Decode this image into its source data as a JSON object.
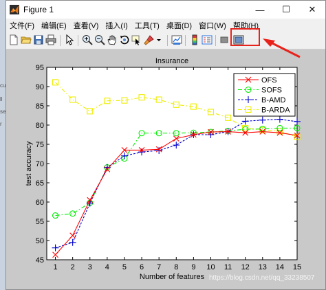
{
  "window": {
    "title": "Figure 1",
    "minimize_glyph": "—",
    "maximize_glyph": "☐",
    "close_glyph": "✕"
  },
  "menu": [
    {
      "key": "file",
      "label": "文件(F)"
    },
    {
      "key": "edit",
      "label": "编辑(E)"
    },
    {
      "key": "view",
      "label": "查看(V)"
    },
    {
      "key": "insert",
      "label": "插入(I)"
    },
    {
      "key": "tools",
      "label": "工具(T)"
    },
    {
      "key": "desktop",
      "label": "桌面(D)"
    },
    {
      "key": "window",
      "label": "窗口(W)"
    },
    {
      "key": "help",
      "label": "帮助(H)"
    }
  ],
  "toolbar_icons": [
    "new-figure-icon",
    "open-file-icon",
    "save-icon",
    "print-icon",
    "edit-plot-arrow-icon",
    "zoom-in-icon",
    "zoom-out-icon",
    "pan-hand-icon",
    "rotate-3d-icon",
    "data-cursor-icon",
    "brush-icon",
    "link-plot-icon",
    "colorbar-icon",
    "legend-icon",
    "hide-plot-tools-icon",
    "show-plot-tools-icon"
  ],
  "left_strip_fragments": [
    "cu",
    "ll",
    "se",
    "r"
  ],
  "watermark": "https://blog.csdn.net/qq_33238507",
  "colors": {
    "ofs": "#ff0000",
    "sofs": "#00ee00",
    "bamd": "#0000cc",
    "barda": "#eeee00",
    "annotation": "#e8221b"
  },
  "chart_data": {
    "type": "line",
    "title": "Insurance",
    "xlabel": "Number of features",
    "ylabel": "test accuracy",
    "x": [
      1,
      2,
      3,
      4,
      5,
      6,
      7,
      8,
      9,
      10,
      11,
      12,
      13,
      14,
      15
    ],
    "xlim": [
      0.5,
      15
    ],
    "ylim": [
      45,
      95
    ],
    "xticks": [
      1,
      2,
      3,
      4,
      5,
      6,
      7,
      8,
      9,
      10,
      11,
      12,
      13,
      14,
      15
    ],
    "yticks": [
      45,
      50,
      55,
      60,
      65,
      70,
      75,
      80,
      85,
      90,
      95
    ],
    "legend_position": "top-right",
    "grid": false,
    "series": [
      {
        "key": "ofs",
        "name": "OFS",
        "marker": "x",
        "line": "solid",
        "values": [
          46.3,
          51.3,
          60.5,
          68.5,
          73.5,
          73.5,
          73.7,
          76.5,
          77.5,
          78.2,
          78.3,
          78.0,
          78.3,
          78.0,
          77.3
        ]
      },
      {
        "key": "sofs",
        "name": "SOFS",
        "marker": "o",
        "line": "dashdot",
        "values": [
          56.5,
          57.0,
          59.8,
          69.0,
          71.3,
          77.9,
          77.9,
          77.9,
          78.0,
          78.2,
          78.5,
          78.9,
          79.0,
          79.2,
          79.2
        ]
      },
      {
        "key": "bamd",
        "name": "B-AMD",
        "marker": "+",
        "line": "dotted",
        "values": [
          48.1,
          49.5,
          59.7,
          69.0,
          72.0,
          73.0,
          73.4,
          74.8,
          77.5,
          77.5,
          78.3,
          81.0,
          81.3,
          81.5,
          80.9
        ]
      },
      {
        "key": "barda",
        "name": "B-ARDA",
        "marker": "s",
        "line": "dashdot",
        "values": [
          91.1,
          86.6,
          83.6,
          86.3,
          86.4,
          87.2,
          86.6,
          85.3,
          84.8,
          83.4,
          81.9,
          79.2,
          78.7,
          78.4,
          76.9
        ]
      }
    ]
  }
}
